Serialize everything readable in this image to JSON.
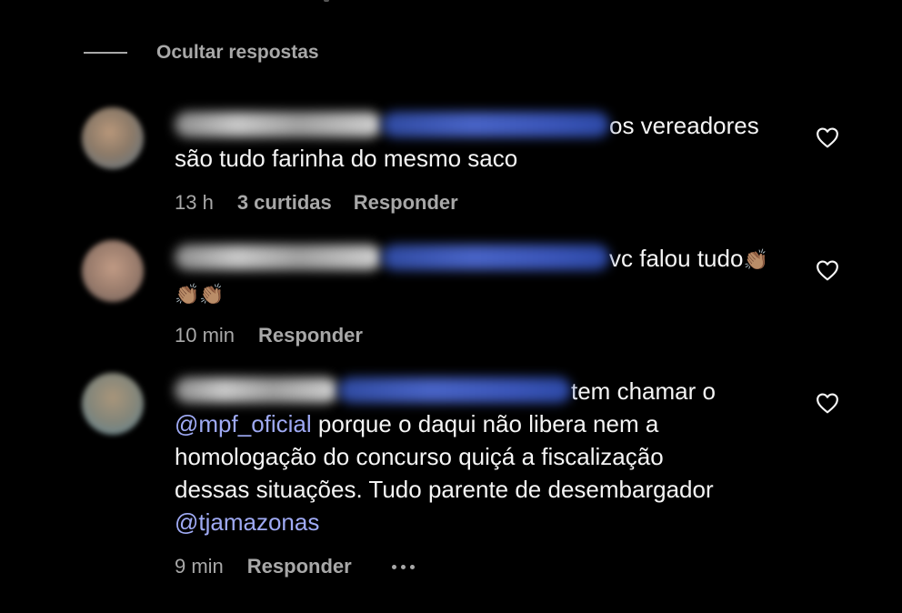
{
  "replies_toggle": {
    "label": "Ocultar respostas"
  },
  "comments": [
    {
      "text_lines": [
        "os vereadores",
        "são tudo farinha do mesmo saco"
      ],
      "time": "13 h",
      "likes": "3 curtidas",
      "reply_label": "Responder",
      "avatar_colors": [
        "#a7896f",
        "#6d8090"
      ]
    },
    {
      "text_lines": [
        "vc falou tudo"
      ],
      "emoji_line1": "👏🏽",
      "emoji_line2": "👏🏽👏🏽",
      "time": "10 min",
      "reply_label": "Responder",
      "avatar_colors": [
        "#b0907c",
        "#8a7063"
      ]
    },
    {
      "text_head": "tem chamar o",
      "mention1": "@mpf_oficial",
      "text_mid": " porque o daqui não libera nem a",
      "text_line3": "homologação do concurso quiçá a fiscalização",
      "text_line4": "dessas situações. Tudo parente de desembargador",
      "mention2": "@tjamazonas",
      "time": "9 min",
      "reply_label": "Responder",
      "avatar_colors": [
        "#9a8a70",
        "#6f8a95"
      ]
    }
  ],
  "icons": {
    "like": "heart-icon",
    "more": "more-options-icon"
  },
  "colors": {
    "background": "#000000",
    "text": "#f5f5f5",
    "secondary": "#a8a8a8",
    "mention": "#9faaf4"
  }
}
